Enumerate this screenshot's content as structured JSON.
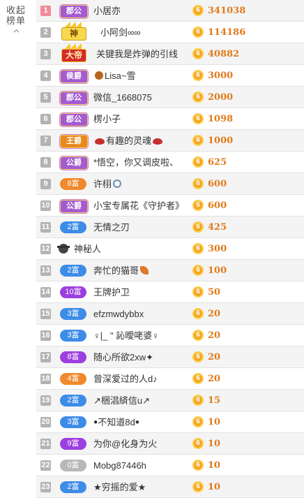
{
  "collapse": {
    "line1": "收起",
    "line2": "榜单"
  },
  "coin_glyph": "6",
  "colors": {
    "noble_purple": "#a35bd1",
    "king_orange": "#e9891c",
    "fans_purple": "#9c3fe0",
    "fans_orange": "#f08a2c",
    "fans_blue": "#3d8ce8",
    "fans_grey": "#b8b8b8",
    "score": "#e07a1a",
    "coin": "#f5a623"
  },
  "rows": [
    {
      "rank": "1",
      "badge_type": "noble",
      "badge": "郡公",
      "name": "小居亦",
      "score": "341038"
    },
    {
      "rank": "2",
      "badge_type": "crown-god",
      "badge": "神",
      "name": "小阿剑∞∞",
      "score": "114186"
    },
    {
      "rank": "3",
      "badge_type": "crown-emperor",
      "badge": "大帝",
      "name": "关键我是炸弹的引线",
      "score": "40882"
    },
    {
      "rank": "4",
      "badge_type": "noble",
      "badge": "侯爵",
      "name": "Lisa~雪",
      "name_icon": "paw-icon",
      "score": "3000"
    },
    {
      "rank": "5",
      "badge_type": "noble",
      "badge": "郡公",
      "name": "微信_1668075",
      "score": "2000"
    },
    {
      "rank": "6",
      "badge_type": "noble",
      "badge": "郡公",
      "name": "楞小子",
      "score": "1098"
    },
    {
      "rank": "7",
      "badge_type": "king",
      "badge": "王爵",
      "name": "有趣的灵魂",
      "name_icon": "lips-icon",
      "name_icon_after": "lips-icon",
      "score": "1000"
    },
    {
      "rank": "8",
      "badge_type": "noble",
      "badge": "公爵",
      "name": "*悟空，你又调皮啦、",
      "score": "625"
    },
    {
      "rank": "9",
      "badge_type": "fans",
      "color": "orange",
      "badge": "6富",
      "name": "许栩",
      "name_icon_after": "ring-icon",
      "score": "600"
    },
    {
      "rank": "10",
      "badge_type": "noble",
      "badge": "公爵",
      "name": "小宝专属花《守护者》",
      "score": "600"
    },
    {
      "rank": "11",
      "badge_type": "fans",
      "color": "blue",
      "badge": "2富",
      "name": "无情之刃",
      "score": "425"
    },
    {
      "rank": "12",
      "badge_type": "mystery",
      "badge": "",
      "name": "神秘人",
      "score": "300"
    },
    {
      "rank": "13",
      "badge_type": "fans",
      "color": "blue",
      "badge": "2富",
      "name": "奔忙的猫哥",
      "name_icon_mid": "leaf-icon",
      "score": "100"
    },
    {
      "rank": "14",
      "badge_type": "fans",
      "color": "purple",
      "badge": "10富",
      "name": "王牌护卫",
      "score": "50"
    },
    {
      "rank": "15",
      "badge_type": "fans",
      "color": "blue",
      "badge": "3富",
      "name": "efzmwdybbx",
      "score": "20"
    },
    {
      "rank": "16",
      "badge_type": "fans",
      "color": "blue",
      "badge": "3富",
      "name": "♀|_ \" 訫曖咾婆♀",
      "score": "20"
    },
    {
      "rank": "17",
      "badge_type": "fans",
      "color": "purple",
      "badge": "8富",
      "name": "随心所欲2xw✦",
      "score": "20"
    },
    {
      "rank": "18",
      "badge_type": "fans",
      "color": "orange",
      "badge": "4富",
      "name": "曾深爱过的人d♪",
      "score": "20"
    },
    {
      "rank": "19",
      "badge_type": "fans",
      "color": "blue",
      "badge": "2富",
      "name": "↗梱淐緕信u↗",
      "score": "15"
    },
    {
      "rank": "20",
      "badge_type": "fans",
      "color": "blue",
      "badge": "3富",
      "name": "ꔷ不知道8dꔷ",
      "score": "10"
    },
    {
      "rank": "21",
      "badge_type": "fans",
      "color": "purple",
      "badge": "9富",
      "name": "为你@化身为火",
      "score": "10"
    },
    {
      "rank": "22",
      "badge_type": "fans",
      "color": "grey",
      "badge": "0富",
      "name": "Mobg87446h",
      "score": "10"
    },
    {
      "rank": "23",
      "badge_type": "fans",
      "color": "blue",
      "badge": "2富",
      "name": "★穷摇的爱★",
      "score": "10"
    }
  ]
}
